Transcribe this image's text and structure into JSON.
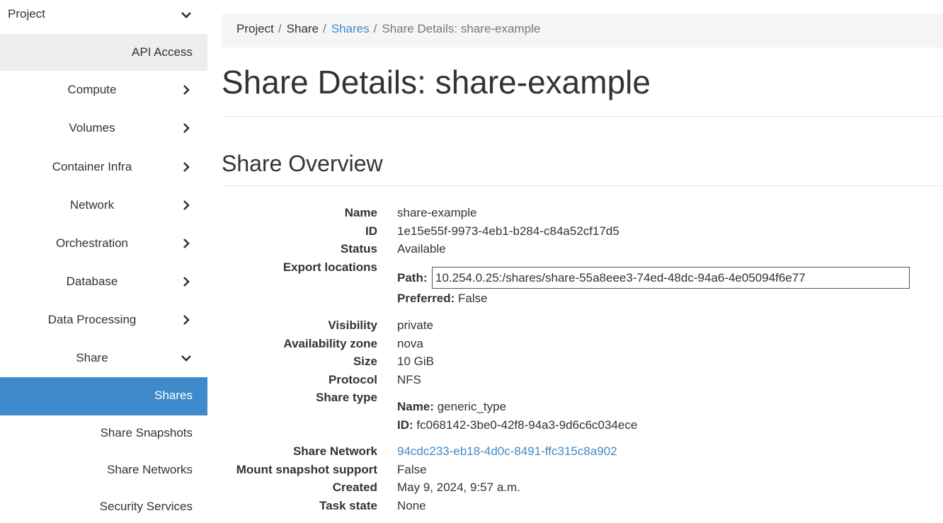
{
  "sidebar": {
    "project": "Project",
    "api_access": "API Access",
    "items": [
      {
        "label": "Compute"
      },
      {
        "label": "Volumes"
      },
      {
        "label": "Container Infra"
      },
      {
        "label": "Network"
      },
      {
        "label": "Orchestration"
      },
      {
        "label": "Database"
      },
      {
        "label": "Data Processing"
      },
      {
        "label": "Share"
      }
    ],
    "active": "Shares",
    "subitems": [
      {
        "label": "Share Snapshots"
      },
      {
        "label": "Share Networks"
      },
      {
        "label": "Security Services"
      }
    ]
  },
  "breadcrumb": {
    "items": [
      "Project",
      "Share",
      "Shares",
      "Share Details: share-example"
    ],
    "separator": "/"
  },
  "page": {
    "title": "Share Details: share-example",
    "section": "Share Overview"
  },
  "details": {
    "name_label": "Name",
    "name": "share-example",
    "id_label": "ID",
    "id": "1e15e55f-9973-4eb1-b284-c84a52cf17d5",
    "status_label": "Status",
    "status": "Available",
    "export_label": "Export locations",
    "path_label": "Path:",
    "path": "10.254.0.25:/shares/share-55a8eee3-74ed-48dc-94a6-4e05094f6e77",
    "preferred_label": "Preferred:",
    "preferred": "False",
    "visibility_label": "Visibility",
    "visibility": "private",
    "az_label": "Availability zone",
    "az": "nova",
    "size_label": "Size",
    "size": "10 GiB",
    "protocol_label": "Protocol",
    "protocol": "NFS",
    "sharetype_label": "Share type",
    "st_name_label": "Name:",
    "st_name": "generic_type",
    "st_id_label": "ID:",
    "st_id": "fc068142-3be0-42f8-94a3-9d6c6c034ece",
    "network_label": "Share Network",
    "network": "94cdc233-eb18-4d0c-8491-ffc315c8a902",
    "mount_label": "Mount snapshot support",
    "mount": "False",
    "created_label": "Created",
    "created": "May 9, 2024, 9:57 a.m.",
    "task_label": "Task state",
    "task": "None"
  },
  "colors": {
    "accent": "#3f8acb",
    "active_bg": "#3f8acb",
    "hover_bg": "#eeeeee"
  }
}
